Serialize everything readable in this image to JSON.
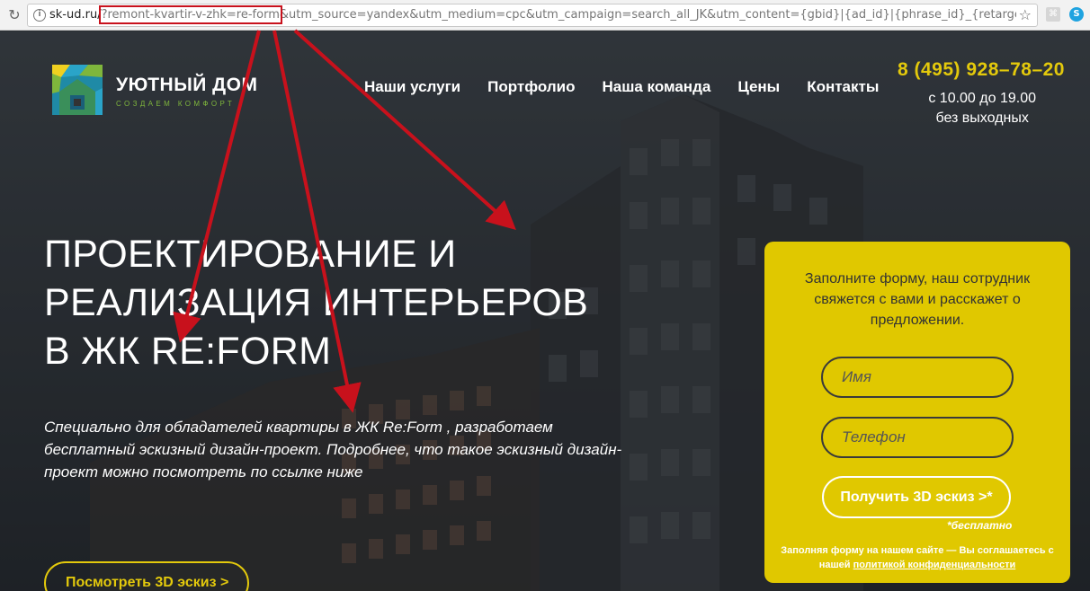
{
  "browser": {
    "reload_icon": "reload-icon",
    "url_host": "sk-ud.ru/",
    "url_highlight": "?remont-kvartir-v-zhk=re-form",
    "url_rest": "&utm_source=yandex&utm_medium=cpc&utm_campaign=search_all_JK&utm_content={gbid}|{ad_id}|{phrase_id}_{retargeti...",
    "highlight_color": "#c8111c"
  },
  "brand": {
    "name": "УЮТНЫЙ ДОМ",
    "tagline": "СОЗДАЕМ КОМФОРТ"
  },
  "nav": {
    "items": [
      {
        "label": "Наши услуги"
      },
      {
        "label": "Портфолио"
      },
      {
        "label": "Наша команда"
      },
      {
        "label": "Цены"
      },
      {
        "label": "Контакты"
      }
    ]
  },
  "contact": {
    "phone": "8 (495) 928–78–20",
    "hours_line1": "с 10.00 до 19.00",
    "hours_line2": "без выходных"
  },
  "hero": {
    "headline": "ПРОЕКТИРОВАНИЕ И РЕАЛИЗАЦИЯ ИНТЕРЬЕРОВ В ЖК RE:FORM",
    "lead": "Специально для обладателей квартиры в ЖК Re:Form , разработаем бесплатный эскизный дизайн-проект. Подробнее, что такое эскизный дизайн-проект можно посмотреть по ссылке ниже",
    "view_button": "Посмотреть 3D эскиз >"
  },
  "form": {
    "intro": "Заполните форму, наш сотрудник свяжется с вами и расскажет о предложении.",
    "name_placeholder": "Имя",
    "phone_placeholder": "Телефон",
    "submit_label": "Получить 3D эскиз >*",
    "free_note": "*бесплатно",
    "consent_text": "Заполняя форму на нашем сайте — Вы соглашаетесь с нашей",
    "consent_link": "политикой конфиденциальности"
  },
  "colors": {
    "accent": "#e0c800",
    "brand_green": "#7fb63c",
    "annotation_red": "#c8111c"
  }
}
